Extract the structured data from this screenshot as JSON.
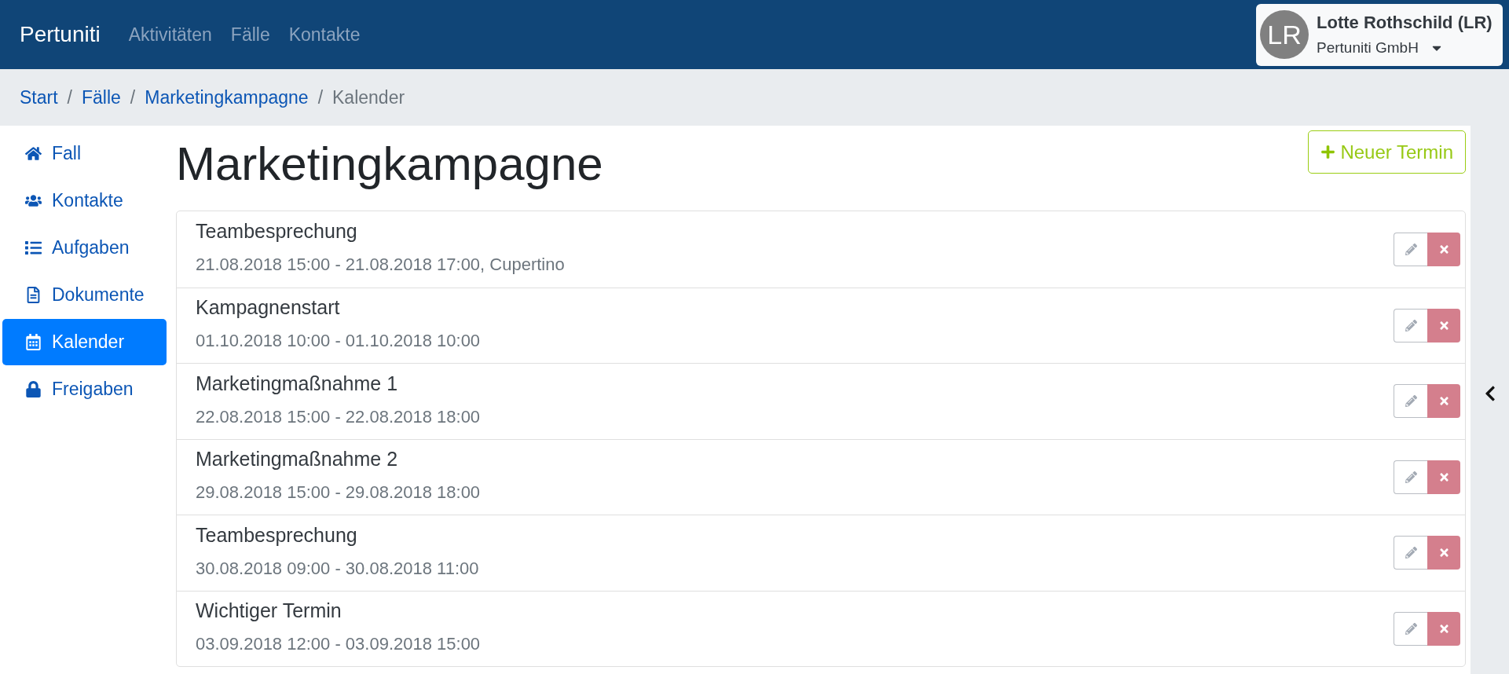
{
  "navbar": {
    "brand": "Pertuniti",
    "links": [
      {
        "label": "Aktivitäten",
        "selected": false
      },
      {
        "label": "Fälle",
        "selected": false
      },
      {
        "label": "Kontakte",
        "selected": false
      }
    ]
  },
  "user_menu": {
    "initials": "LR",
    "name": "Lotte Rothschild (LR)",
    "company": "Pertuniti GmbH"
  },
  "breadcrumb": {
    "items": [
      {
        "label": "Start",
        "current": false
      },
      {
        "separator_before": "/",
        "label": "Fälle",
        "current": false
      },
      {
        "separator_before": "/",
        "label": "Marketingkampagne",
        "current": false
      },
      {
        "separator_before": "/",
        "label": "Kalender",
        "current": true
      }
    ]
  },
  "sidebar": {
    "items": [
      {
        "label": "Fall",
        "selected": false
      },
      {
        "label": "Kontakte",
        "selected": false
      },
      {
        "label": "Aufgaben",
        "selected": false
      },
      {
        "label": "Dokumente",
        "selected": false
      },
      {
        "label": "Kalender",
        "selected": true
      },
      {
        "label": "Freigaben",
        "selected": false
      }
    ]
  },
  "page": {
    "title": "Marketingkampagne",
    "new_button": "Neuer Termin"
  },
  "appointments": [
    {
      "title": "Teambesprechung",
      "time": "21.08.2018 15:00 - 21.08.2018 17:00, Cupertino"
    },
    {
      "title": "Kampagnenstart",
      "time": "01.10.2018 10:00 - 01.10.2018 10:00"
    },
    {
      "title": "Marketingmaßnahme 1",
      "time": "22.08.2018 15:00 - 22.08.2018 18:00"
    },
    {
      "title": "Marketingmaßnahme 2",
      "time": "29.08.2018 15:00 - 29.08.2018 18:00"
    },
    {
      "title": "Teambesprechung",
      "time": "30.08.2018 09:00 - 30.08.2018 11:00"
    },
    {
      "title": "Wichtiger Termin",
      "time": "03.09.2018 12:00 - 03.09.2018 15:00"
    }
  ]
}
